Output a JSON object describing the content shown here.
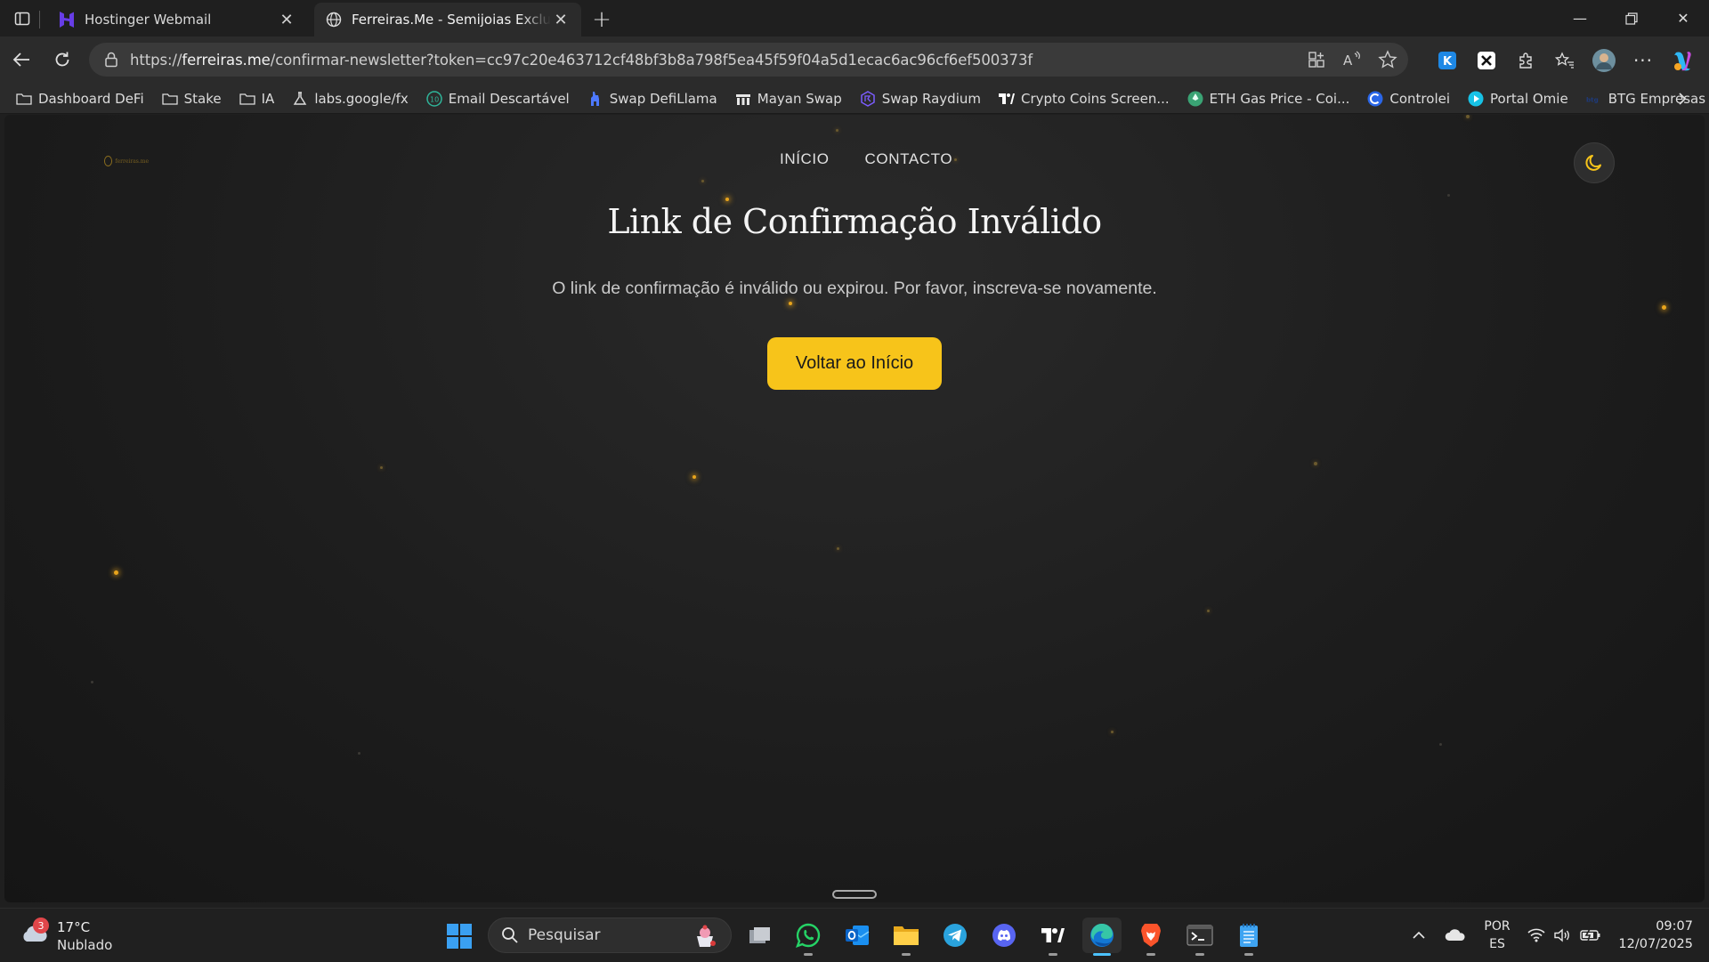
{
  "browser": {
    "tabs": [
      {
        "title": "Hostinger Webmail",
        "active": false
      },
      {
        "title": "Ferreiras.Me - Semijoias Exclusivas",
        "active": true
      }
    ],
    "address": {
      "scheme": "https://",
      "host": "ferreiras.me",
      "path": "/confirmar-newsletter?token=cc97c20e463712cf48bf3b8a798f5ea45f59f04a5d1ecac6ac96cf6ef500373f"
    },
    "bookmarks": [
      {
        "label": "Dashboard DeFi",
        "icon": "folder-icon"
      },
      {
        "label": "Stake",
        "icon": "folder-icon"
      },
      {
        "label": "IA",
        "icon": "folder-icon"
      },
      {
        "label": "labs.google/fx",
        "icon": "flask-icon"
      },
      {
        "label": "Email Descartável",
        "icon": "email-icon"
      },
      {
        "label": "Swap DefiLlama",
        "icon": "llama-icon"
      },
      {
        "label": "Mayan Swap",
        "icon": "mayan-icon"
      },
      {
        "label": "Swap Raydium",
        "icon": "raydium-icon"
      },
      {
        "label": "Crypto Coins Screen...",
        "icon": "tradingview-icon"
      },
      {
        "label": "ETH Gas Price - Coi...",
        "icon": "gas-icon"
      },
      {
        "label": "Controlei",
        "icon": "controlei-icon"
      },
      {
        "label": "Portal Omie",
        "icon": "omie-icon"
      },
      {
        "label": "BTG Empresas",
        "icon": "btg-icon"
      }
    ]
  },
  "site": {
    "logo_text": "ferreiras.me",
    "nav": [
      "INÍCIO",
      "CONTACTO"
    ],
    "title": "Link de Confirmação Inválido",
    "message": "O link de confirmação é inválido ou expirou. Por favor, inscreva-se novamente.",
    "cta_label": "Voltar ao Início",
    "accent": "#f7c41a"
  },
  "taskbar": {
    "weather": {
      "temp": "17°C",
      "condition": "Nublado",
      "alerts": "3"
    },
    "search_label": "Pesquisar",
    "apps": [
      "task-view",
      "whatsapp",
      "outlook",
      "file-explorer",
      "telegram",
      "discord",
      "tradingview",
      "edge",
      "brave",
      "terminal",
      "notepad"
    ],
    "language": {
      "line1": "POR",
      "line2": "ES"
    },
    "time": "09:07",
    "date": "12/07/2025"
  }
}
